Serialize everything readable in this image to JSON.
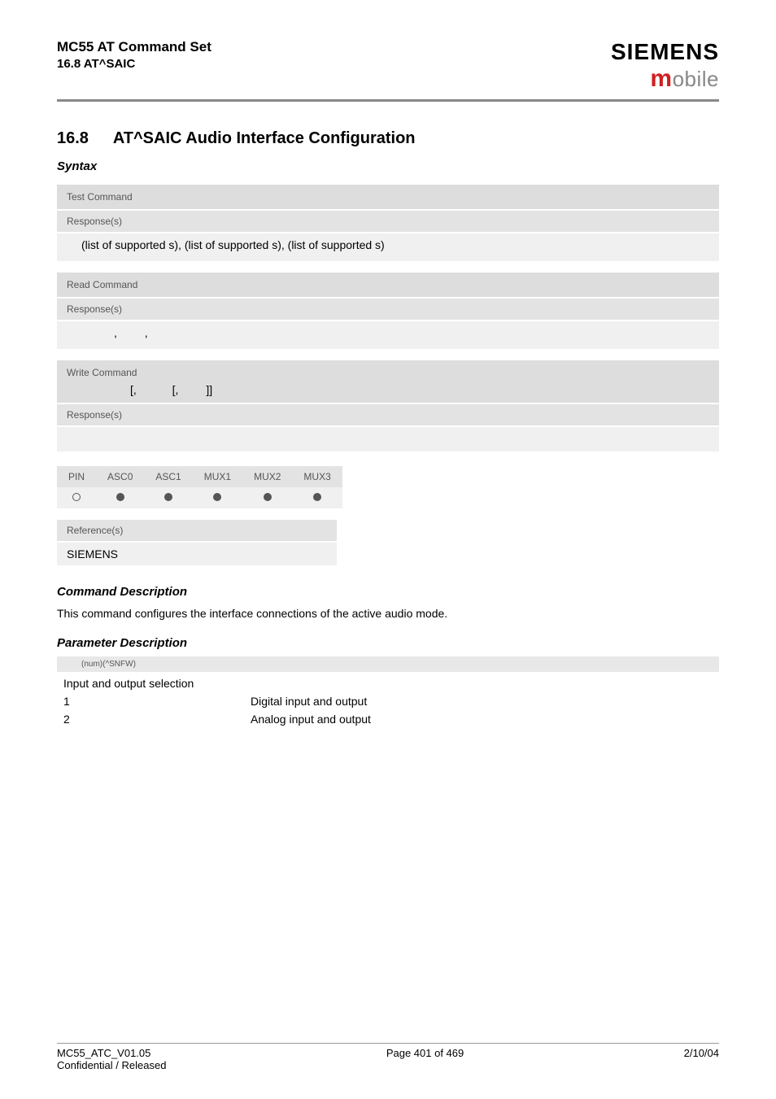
{
  "header": {
    "doc_title": "MC55 AT Command Set",
    "doc_sub": "16.8 AT^SAIC",
    "brand": "SIEMENS",
    "brand_sub_m": "m",
    "brand_sub_rest": "obile"
  },
  "section": {
    "num": "16.8",
    "title": "AT^SAIC   Audio Interface Configuration"
  },
  "syntax_heading": "Syntax",
  "test_block": {
    "head": "Test Command",
    "resp_label": "Response(s)",
    "line_prefix": "(list of supported ",
    "line_mid1": "s), (list of supported ",
    "line_mid2": "s), (list of supported ",
    "line_suffix": "s)"
  },
  "read_block": {
    "head": "Read Command",
    "resp_label": "Response(s)",
    "sep1": ", ",
    "sep2": ", "
  },
  "write_block": {
    "head": "Write Command",
    "open": "[, ",
    "mid": "[, ",
    "close": "]]",
    "resp_label": "Response(s)"
  },
  "support": {
    "cols": [
      "PIN",
      "ASC0",
      "ASC1",
      "MUX1",
      "MUX2",
      "MUX3"
    ],
    "vals": [
      "empty",
      "filled",
      "filled",
      "filled",
      "filled",
      "filled"
    ]
  },
  "reference": {
    "head": "Reference(s)",
    "body": "SIEMENS"
  },
  "cmd_desc_heading": "Command Description",
  "cmd_desc_text": "This command configures the interface connections of the active audio mode.",
  "param_desc_heading": "Parameter Description",
  "param_bar": "(num)(^SNFW)",
  "param_title": "Input and output selection",
  "param_rows": [
    {
      "key": "1",
      "val": "Digital input and output"
    },
    {
      "key": "2",
      "val": "Analog input and output"
    }
  ],
  "footer": {
    "left1": "MC55_ATC_V01.05",
    "left2": "Confidential / Released",
    "center": "Page 401 of 469",
    "right": "2/10/04"
  }
}
